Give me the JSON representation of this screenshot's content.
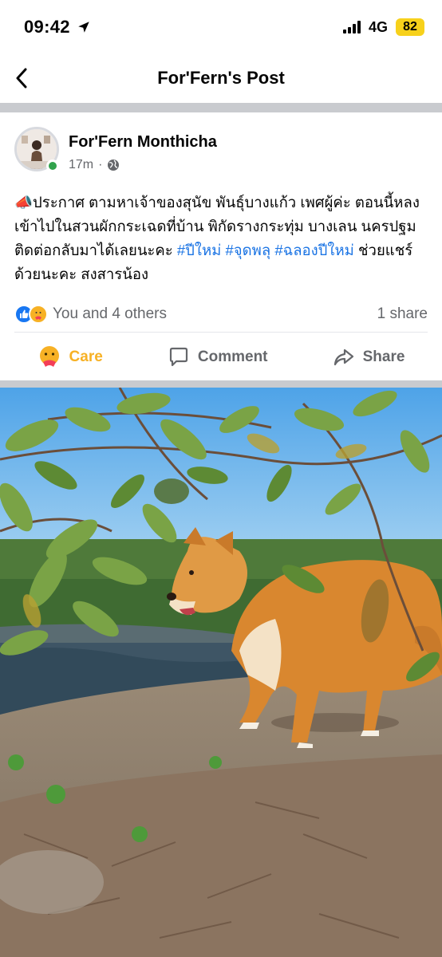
{
  "status_bar": {
    "time": "09:42",
    "network": "4G",
    "battery": "82"
  },
  "nav": {
    "title": "For'Fern's Post"
  },
  "post": {
    "author": "For'Fern Monthicha",
    "time_ago": "17m",
    "separator": "·",
    "text_intro": "📣ประกาศ ตามหาเจ้าของสุนัข พันธุ์บางแก้ว เพศผู้ค่ะ ตอนนี้หลงเข้าไปในสวนผักกระเฉดที่บ้าน พิกัดรางกระทุ่ม บางเลน นครปฐม ติดต่อกลับมาได้เลยนะคะ ",
    "hashtag_1": "#ปีใหม่",
    "hashtag_2": "#จุดพลุ",
    "hashtag_3": "#ฉลองปีใหม่",
    "text_outro": " ช่วยแชร์ด้วยนะคะ สงสารน้อง",
    "reactions_text": "You and 4 others",
    "share_count": "1 share"
  },
  "actions": {
    "care": "Care",
    "comment": "Comment",
    "share": "Share"
  },
  "colors": {
    "accent_blue": "#1b74e4",
    "care_yellow": "#f7b125",
    "online_green": "#31a24c",
    "secondary_text": "#65676b",
    "battery_yellow": "#f7d11b"
  },
  "icons": [
    "location-arrow-icon",
    "signal-icon",
    "back-chevron-icon",
    "globe-icon",
    "like-icon",
    "care-icon",
    "comment-icon",
    "share-icon"
  ]
}
